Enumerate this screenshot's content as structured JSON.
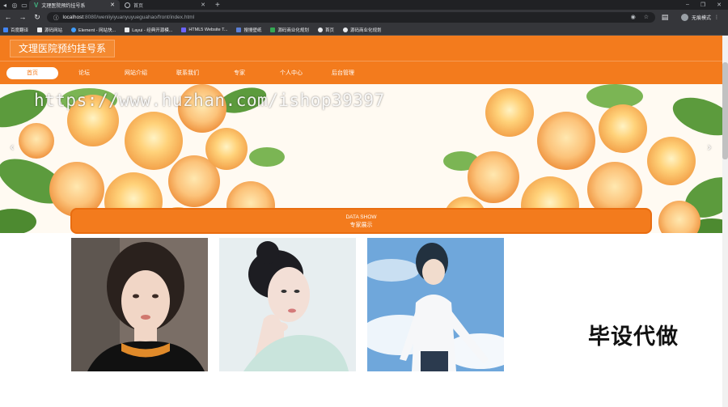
{
  "browser": {
    "tabs": [
      {
        "title": "文理医院预约挂号系",
        "active": true
      },
      {
        "title": "首页",
        "active": false
      }
    ],
    "new_tab": "+",
    "url_host": "localhost",
    "url_path": ":8080/wenliyiyuanyuyueguahao/front/index.html",
    "profile_label": "无痕模式",
    "bookmarks": [
      "百度翻译",
      "源码网站",
      "Element - 网站快...",
      "Layui - 经典开源模...",
      "HTML5 Website T...",
      "搜搜壁纸",
      "源码商业化规划",
      "首页",
      "源码商业化规划"
    ]
  },
  "site": {
    "title": "文理医院预约挂号系",
    "menu": [
      "首页",
      "论坛",
      "网站介绍",
      "联系我们",
      "专家",
      "个人中心",
      "后台管理"
    ]
  },
  "banner": {
    "watermark": "https://www.huzhan.com/ishop39397",
    "prev": "‹",
    "next": "›"
  },
  "section": {
    "en": "DATA SHOW",
    "cn": "专家展示"
  },
  "stamp": "毕设代做",
  "colors": {
    "brand": "#f37b1d",
    "chrome_dark": "#202124",
    "chrome_mid": "#35363a"
  }
}
